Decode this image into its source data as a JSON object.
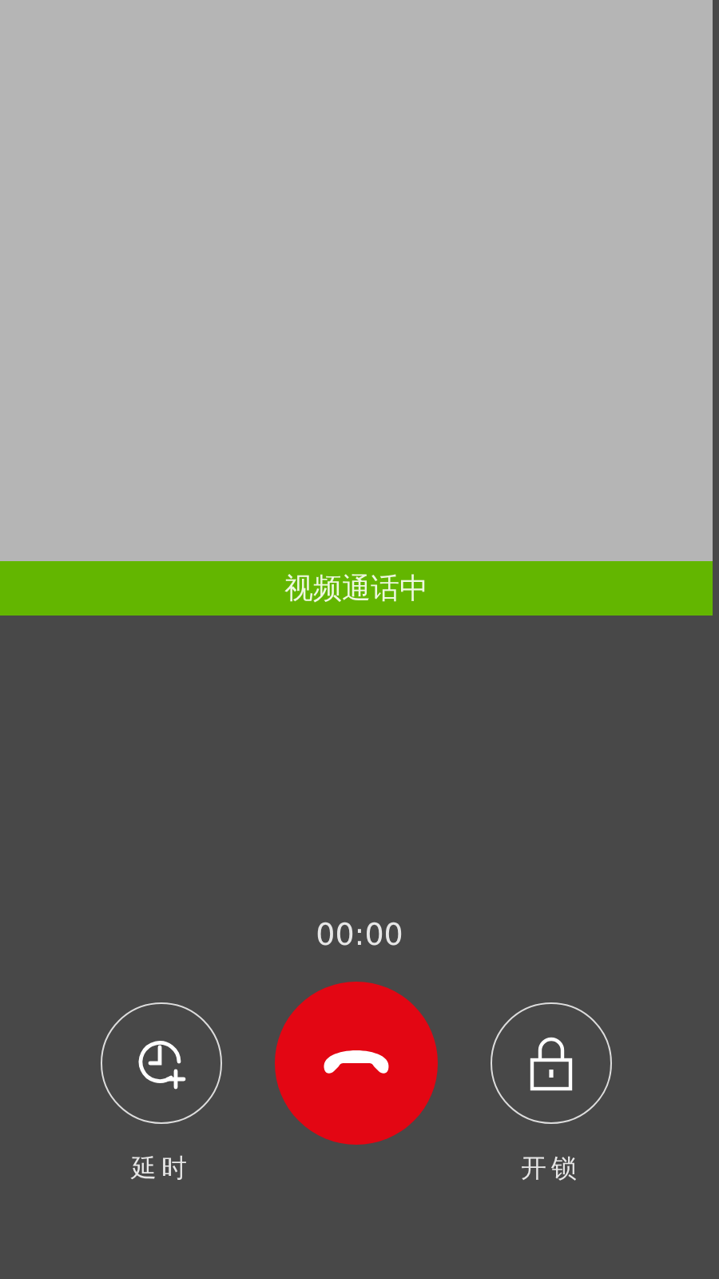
{
  "status_bar": {
    "text": "视频通话中"
  },
  "timer": "00:00",
  "actions": [
    {
      "kind": "delay",
      "label": "延时"
    },
    {
      "kind": "hangup"
    },
    {
      "kind": "unlock",
      "label": "开锁"
    }
  ]
}
